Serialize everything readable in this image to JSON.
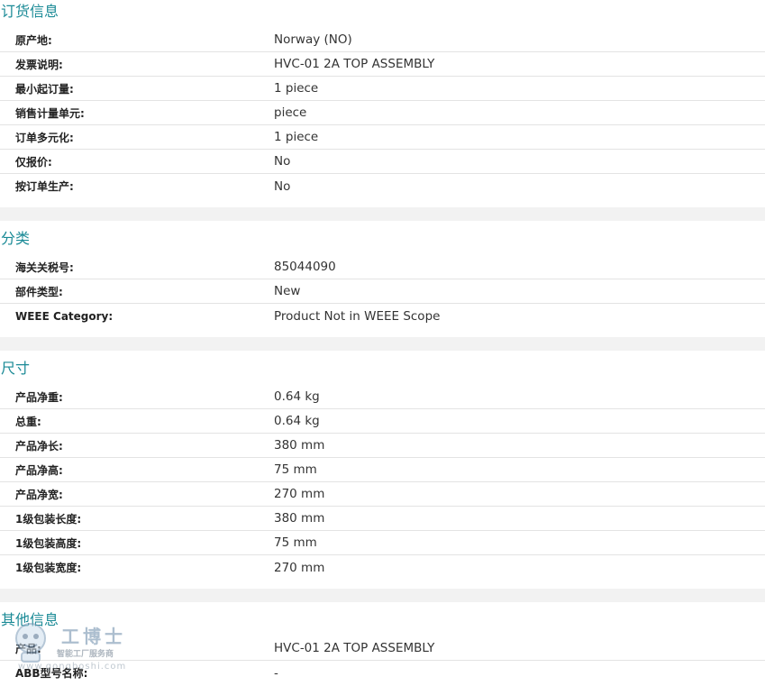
{
  "sections": [
    {
      "title": "订货信息",
      "rows": [
        {
          "label": "原产地:",
          "value": "Norway (NO)"
        },
        {
          "label": "发票说明:",
          "value": "HVC-01 2A TOP ASSEMBLY"
        },
        {
          "label": "最小起订量:",
          "value": "1 piece"
        },
        {
          "label": "销售计量单元:",
          "value": "piece"
        },
        {
          "label": "订单多元化:",
          "value": "1 piece"
        },
        {
          "label": "仅报价:",
          "value": "No"
        },
        {
          "label": "按订单生产:",
          "value": "No"
        }
      ]
    },
    {
      "title": "分类",
      "rows": [
        {
          "label": "海关关税号:",
          "value": "85044090"
        },
        {
          "label": "部件类型:",
          "value": "New"
        },
        {
          "label": "WEEE Category:",
          "value": "Product Not in WEEE Scope"
        }
      ]
    },
    {
      "title": "尺寸",
      "rows": [
        {
          "label": "产品净重:",
          "value": "0.64 kg"
        },
        {
          "label": "总重:",
          "value": "0.64 kg"
        },
        {
          "label": "产品净长:",
          "value": "380 mm"
        },
        {
          "label": "产品净高:",
          "value": "75 mm"
        },
        {
          "label": "产品净宽:",
          "value": "270 mm"
        },
        {
          "label": "1级包装长度:",
          "value": "380 mm"
        },
        {
          "label": "1级包装高度:",
          "value": "75 mm"
        },
        {
          "label": "1级包装宽度:",
          "value": "270 mm"
        }
      ]
    },
    {
      "title": "其他信息",
      "rows": [
        {
          "label": "产品:",
          "value": "HVC-01 2A TOP ASSEMBLY"
        },
        {
          "label": "ABB型号名称:",
          "value": "-"
        }
      ]
    }
  ],
  "watermark": {
    "main": "工博士",
    "sub": "智能工厂服务商",
    "url": "www.gongboshi.com"
  },
  "colors": {
    "section_title": "#1a8a96",
    "band": "#f2f2f2",
    "divider": "#e3e3e3"
  }
}
